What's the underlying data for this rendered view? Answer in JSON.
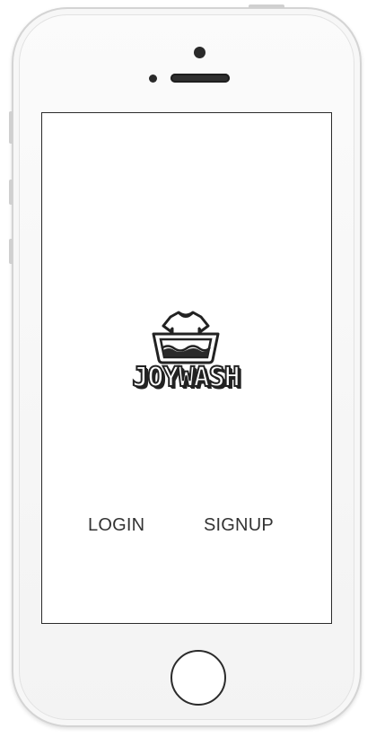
{
  "app": {
    "logo_text": "JOYWASH",
    "logo_icon": "washing-tshirt-basin-icon"
  },
  "actions": {
    "login_label": "LOGIN",
    "signup_label": "SIGNUP"
  },
  "colors": {
    "text": "#333333",
    "screen_border": "#2b2b2b",
    "device_body": "#f5f5f5"
  }
}
